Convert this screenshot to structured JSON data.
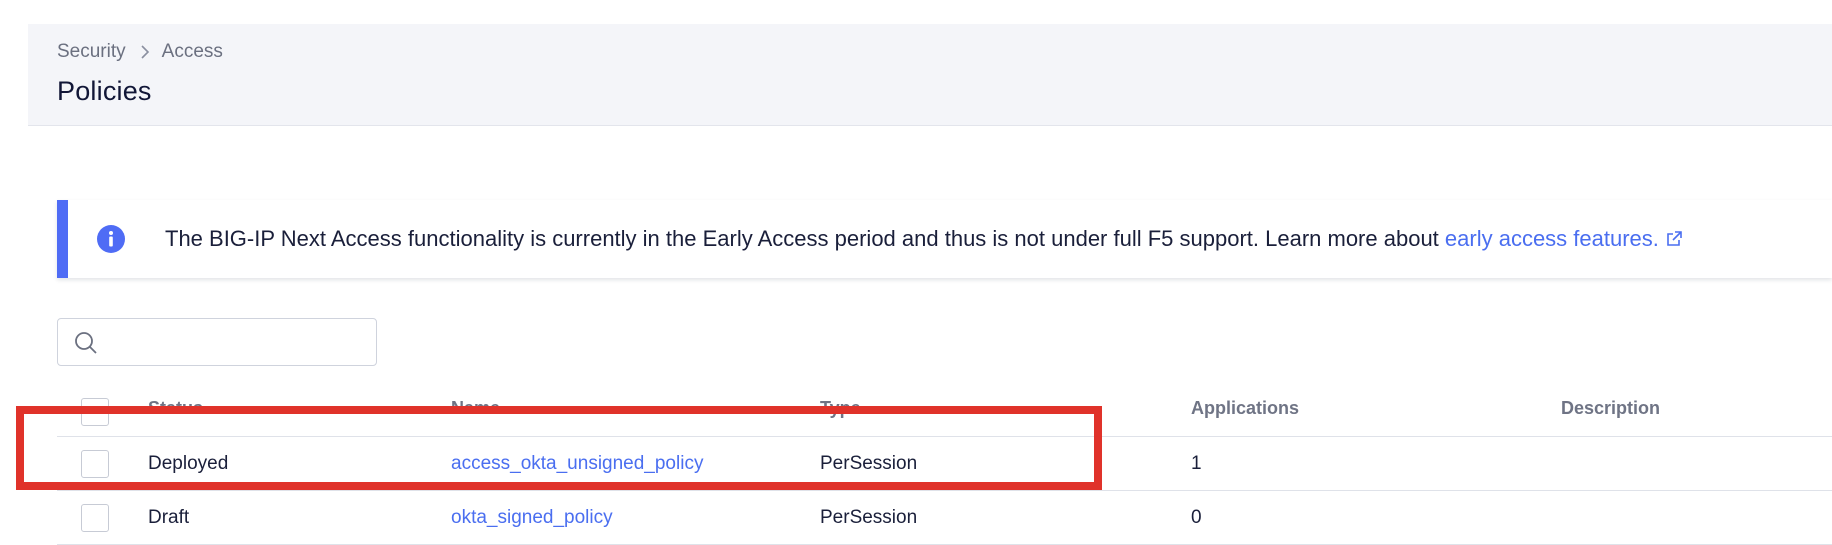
{
  "breadcrumb": {
    "items": [
      "Security",
      "Access"
    ]
  },
  "page": {
    "title": "Policies"
  },
  "banner": {
    "text": "The BIG-IP Next Access functionality is currently in the Early Access period and thus is not under full F5 support. Learn more about ",
    "link_text": "early access features.",
    "accent_color": "#4f6cf5",
    "icon": "info-icon"
  },
  "search": {
    "placeholder": "",
    "value": "",
    "icon": "search-icon"
  },
  "table": {
    "columns": [
      "Status",
      "Name",
      "Type",
      "Applications",
      "Description"
    ],
    "rows": [
      {
        "status": "Deployed",
        "name": "access_okta_unsigned_policy",
        "type": "PerSession",
        "applications": "1",
        "description": ""
      },
      {
        "status": "Draft",
        "name": "okta_signed_policy",
        "type": "PerSession",
        "applications": "0",
        "description": ""
      }
    ]
  },
  "highlight": {
    "color": "#e0322a"
  }
}
